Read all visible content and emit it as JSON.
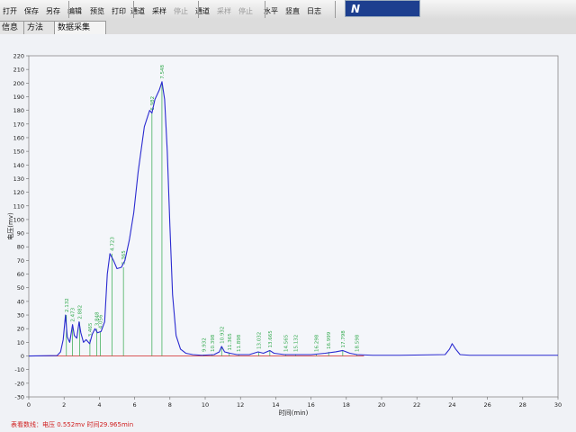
{
  "toolbar": {
    "buttons": [
      {
        "label": "打开"
      },
      {
        "label": "保存"
      },
      {
        "label": "另存"
      },
      {
        "label": "编辑"
      },
      {
        "label": "预览"
      },
      {
        "label": "打印"
      },
      {
        "label": "通道"
      },
      {
        "label": "采样"
      },
      {
        "label": "停止",
        "disabled": true
      },
      {
        "label": "通道"
      },
      {
        "label": "采样",
        "disabled": true
      },
      {
        "label": "停止",
        "disabled": true
      },
      {
        "label": "水平"
      },
      {
        "label": "竖直"
      },
      {
        "label": "日志"
      }
    ],
    "logo_text": "N"
  },
  "tabs": [
    {
      "label": "信息"
    },
    {
      "label": "方法"
    },
    {
      "label": "数据采集",
      "active": true
    }
  ],
  "chart_data": {
    "type": "line",
    "xlabel": "时间(min)",
    "ylabel": "电压(mv)",
    "xlim": [
      0,
      30
    ],
    "ylim": [
      -30,
      220
    ],
    "xticks": [
      0,
      2,
      4,
      6,
      8,
      10,
      12,
      14,
      16,
      18,
      20,
      22,
      24,
      26,
      28,
      30
    ],
    "yticks": [
      -30,
      -20,
      -10,
      0,
      10,
      20,
      30,
      40,
      50,
      60,
      70,
      80,
      90,
      100,
      110,
      120,
      130,
      140,
      150,
      160,
      170,
      180,
      190,
      200,
      210,
      220
    ],
    "grid": false,
    "series": [
      {
        "color": "#2a2ad0",
        "points": [
          [
            0.0,
            0
          ],
          [
            1.6,
            0.3
          ],
          [
            1.8,
            3
          ],
          [
            1.95,
            12
          ],
          [
            2.08,
            30
          ],
          [
            2.18,
            14
          ],
          [
            2.32,
            10
          ],
          [
            2.48,
            23
          ],
          [
            2.58,
            15
          ],
          [
            2.72,
            13
          ],
          [
            2.85,
            25
          ],
          [
            2.95,
            17
          ],
          [
            3.1,
            10
          ],
          [
            3.25,
            12
          ],
          [
            3.45,
            9
          ],
          [
            3.6,
            16
          ],
          [
            3.75,
            20
          ],
          [
            3.9,
            17
          ],
          [
            4.1,
            18
          ],
          [
            4.3,
            25
          ],
          [
            4.45,
            60
          ],
          [
            4.6,
            75
          ],
          [
            4.8,
            70
          ],
          [
            5.0,
            64
          ],
          [
            5.25,
            65
          ],
          [
            5.45,
            70
          ],
          [
            5.7,
            85
          ],
          [
            5.95,
            105
          ],
          [
            6.2,
            135
          ],
          [
            6.55,
            168
          ],
          [
            6.85,
            180
          ],
          [
            6.98,
            178
          ],
          [
            7.15,
            188
          ],
          [
            7.4,
            195
          ],
          [
            7.55,
            201
          ],
          [
            7.7,
            188
          ],
          [
            7.85,
            150
          ],
          [
            8.0,
            95
          ],
          [
            8.15,
            45
          ],
          [
            8.35,
            15
          ],
          [
            8.6,
            5
          ],
          [
            8.9,
            2
          ],
          [
            9.3,
            1
          ],
          [
            9.8,
            0.5
          ],
          [
            10.5,
            1
          ],
          [
            10.8,
            3
          ],
          [
            10.93,
            7
          ],
          [
            11.1,
            3
          ],
          [
            11.4,
            2
          ],
          [
            11.8,
            1
          ],
          [
            12.5,
            1
          ],
          [
            13.0,
            3
          ],
          [
            13.3,
            2
          ],
          [
            13.66,
            4
          ],
          [
            13.9,
            2
          ],
          [
            14.5,
            1
          ],
          [
            15.0,
            1
          ],
          [
            16.0,
            1
          ],
          [
            16.8,
            2
          ],
          [
            17.4,
            3
          ],
          [
            17.8,
            4
          ],
          [
            18.2,
            2
          ],
          [
            18.6,
            1
          ],
          [
            19.5,
            0.5
          ],
          [
            21,
            0.5
          ],
          [
            23.6,
            1
          ],
          [
            23.85,
            5
          ],
          [
            24.0,
            9
          ],
          [
            24.2,
            5
          ],
          [
            24.45,
            1
          ],
          [
            25,
            0.5
          ],
          [
            30,
            0.5
          ]
        ]
      }
    ],
    "baseline": {
      "color": "#d02020",
      "y": 0,
      "x_range": [
        0,
        19.0
      ]
    },
    "peak_color": "#2fa84a",
    "peaks": [
      {
        "t": 2.132,
        "label": "2.132",
        "h": 30
      },
      {
        "t": 2.473,
        "label": "2.473",
        "h": 23
      },
      {
        "t": 2.882,
        "label": "2.882",
        "h": 25
      },
      {
        "t": 3.465,
        "label": "3.465",
        "h": 12
      },
      {
        "t": 3.848,
        "label": "3.848",
        "h": 20
      },
      {
        "t": 4.056,
        "label": "4.056",
        "h": 18
      },
      {
        "t": 4.723,
        "label": "4.723",
        "h": 75
      },
      {
        "t": 5.365,
        "label": "5.365",
        "h": 65
      },
      {
        "t": 6.982,
        "label": "6.982",
        "h": 178
      },
      {
        "t": 7.548,
        "label": "7.548",
        "h": 201
      },
      {
        "t": 9.932,
        "label": "9.932",
        "h": 1
      },
      {
        "t": 10.398,
        "label": "10.398",
        "h": 1
      },
      {
        "t": 10.932,
        "label": "10.932",
        "h": 7
      },
      {
        "t": 11.365,
        "label": "11.365",
        "h": 2
      },
      {
        "t": 11.898,
        "label": "11.898",
        "h": 1
      },
      {
        "t": 13.032,
        "label": "13.032",
        "h": 3
      },
      {
        "t": 13.665,
        "label": "13.665",
        "h": 4
      },
      {
        "t": 14.565,
        "label": "14.565",
        "h": 1
      },
      {
        "t": 15.132,
        "label": "15.132",
        "h": 1
      },
      {
        "t": 16.298,
        "label": "16.298",
        "h": 1
      },
      {
        "t": 16.999,
        "label": "16.999",
        "h": 3
      },
      {
        "t": 17.798,
        "label": "17.798",
        "h": 4
      },
      {
        "t": 18.598,
        "label": "18.598",
        "h": 1
      }
    ]
  },
  "status_text": "表看数线：电压 0.552mv 时间29.965min"
}
